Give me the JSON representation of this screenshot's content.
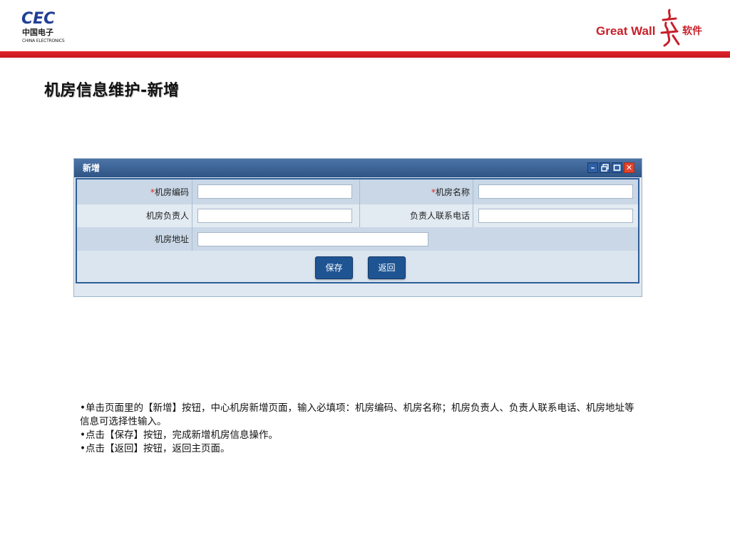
{
  "header": {
    "left_logo": {
      "word": "CEC",
      "cn": "中国电子",
      "en": "CHINA ELECTRONICS"
    },
    "right_logo": {
      "word": "Great Wall",
      "cn": "软件"
    },
    "accent_color": "#d9232b"
  },
  "page_title": "机房信息维护-新增",
  "dialog": {
    "title": "新增",
    "window_buttons": [
      "minimize-icon",
      "restore-icon",
      "maximize-icon",
      "close-icon"
    ],
    "fields": [
      {
        "label": "机房编码",
        "required": true,
        "value": ""
      },
      {
        "label": "机房名称",
        "required": true,
        "value": ""
      },
      {
        "label": "机房负责人",
        "required": false,
        "value": ""
      },
      {
        "label": "负责人联系电话",
        "required": false,
        "value": ""
      },
      {
        "label": "机房地址",
        "required": false,
        "value": ""
      }
    ],
    "required_mark": "*",
    "buttons": {
      "save": "保存",
      "back": "返回"
    }
  },
  "notes": [
    "•单击页面里的【新增】按钮，中心机房新增页面，输入必填项：机房编码、机房名称；机房负责人、负责人联系电话、机房地址等信息可选择性输入。",
    "•点击【保存】按钮，完成新增机房信息操作。",
    "•点击【返回】按钮，返回主页面。"
  ]
}
